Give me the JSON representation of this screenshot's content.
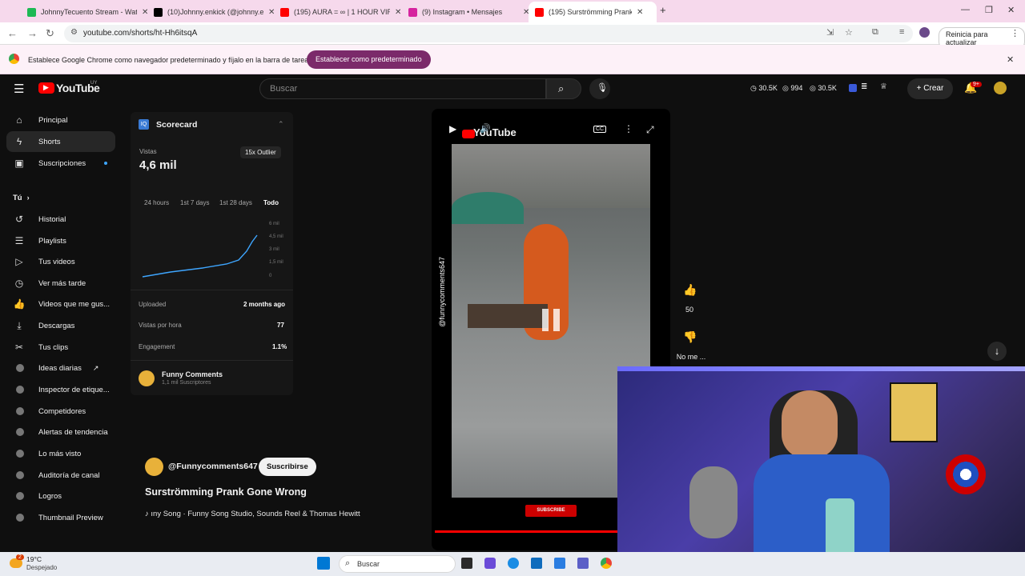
{
  "browser": {
    "tabs": [
      {
        "title": "JohnnyTecuento Stream - Watc",
        "color": "#1db954"
      },
      {
        "title": "(10)Johnny.enkick (@johnny.en",
        "color": "#000000"
      },
      {
        "title": "(195) AURA = ∞ | 1 HOUR VIR",
        "color": "#ff0000"
      },
      {
        "title": "(9) Instagram • Mensajes",
        "color": "#d6249f"
      },
      {
        "title": "(195) Surströmming Prank",
        "color": "#ff0000"
      }
    ],
    "url": "youtube.com/shorts/ht-Hh6itsqA",
    "restart_label": "Reinicia para actualizar",
    "infobar_text": "Establece Google Chrome como navegador predeterminado y fíjalo en la barra de tareas",
    "infobar_button": "Establecer como predeterminado"
  },
  "youtube": {
    "logo": "YouTube",
    "logo_sup": "UY",
    "search_placeholder": "Buscar",
    "stats": [
      "30.5K",
      "994",
      "30.5K"
    ],
    "create_label": "Crear",
    "notif_badge": "9+"
  },
  "sidebar": {
    "items": [
      {
        "label": "Principal",
        "icon": "home-icon"
      },
      {
        "label": "Shorts",
        "icon": "shorts-icon"
      },
      {
        "label": "Suscripciones",
        "icon": "subscriptions-icon"
      },
      {
        "label": "Tú",
        "icon": ""
      },
      {
        "label": "Historial",
        "icon": "history-icon"
      },
      {
        "label": "Playlists",
        "icon": "playlists-icon"
      },
      {
        "label": "Tus videos",
        "icon": "videos-icon"
      },
      {
        "label": "Ver más tarde",
        "icon": "clock-icon"
      },
      {
        "label": "Videos que me gus...",
        "icon": "like-icon"
      },
      {
        "label": "Descargas",
        "icon": "download-icon"
      },
      {
        "label": "Tus clips",
        "icon": "scissors-icon"
      },
      {
        "label": "Ideas diarias",
        "icon": "vidiq-icon"
      },
      {
        "label": "Inspector de etique...",
        "icon": "vidiq-icon"
      },
      {
        "label": "Competidores",
        "icon": "vidiq-icon"
      },
      {
        "label": "Alertas de tendencia",
        "icon": "vidiq-icon"
      },
      {
        "label": "Lo más visto",
        "icon": "vidiq-icon"
      },
      {
        "label": "Auditoría de canal",
        "icon": "vidiq-icon"
      },
      {
        "label": "Logros",
        "icon": "vidiq-icon"
      },
      {
        "label": "Thumbnail Preview",
        "icon": "vidiq-icon"
      }
    ]
  },
  "scorecard": {
    "title": "Scorecard",
    "views_label": "Vistas",
    "views_value": "4,6 mil",
    "outlier": "15x Outlier",
    "ranges": [
      "24 hours",
      "1st 7 days",
      "1st 28 days",
      "Todo"
    ],
    "y_ticks": [
      "6 mil",
      "4,5 mil",
      "3 mil",
      "1,5 mil",
      "0"
    ],
    "rows": [
      {
        "label": "Uploaded",
        "value": "2 months ago"
      },
      {
        "label": "Vistas por hora",
        "value": "77"
      },
      {
        "label": "Engagement",
        "value": "1.1%"
      }
    ],
    "channel": "Funny Comments",
    "channel_subs": "1,1 mil Suscriptores",
    "chart_color": "#3ea6ff"
  },
  "video": {
    "channel": "@Funnycomments647",
    "subscribe": "Suscribirse",
    "title": "Surströmming Prank Gone Wrong",
    "music": "ıny Song · Funny Song Studio, Sounds Reel & Thomas Hewitt",
    "watermark": "@funnycomments647",
    "player_logo": "YouTube",
    "cc": "CC",
    "subscribe_overlay": "SUBSCRIBE"
  },
  "actions": {
    "likes": "50",
    "dislike": "No me ..."
  },
  "taskbar": {
    "temp": "19°C",
    "weather": "Despejado",
    "search": "Buscar",
    "weather_badge": "2"
  }
}
